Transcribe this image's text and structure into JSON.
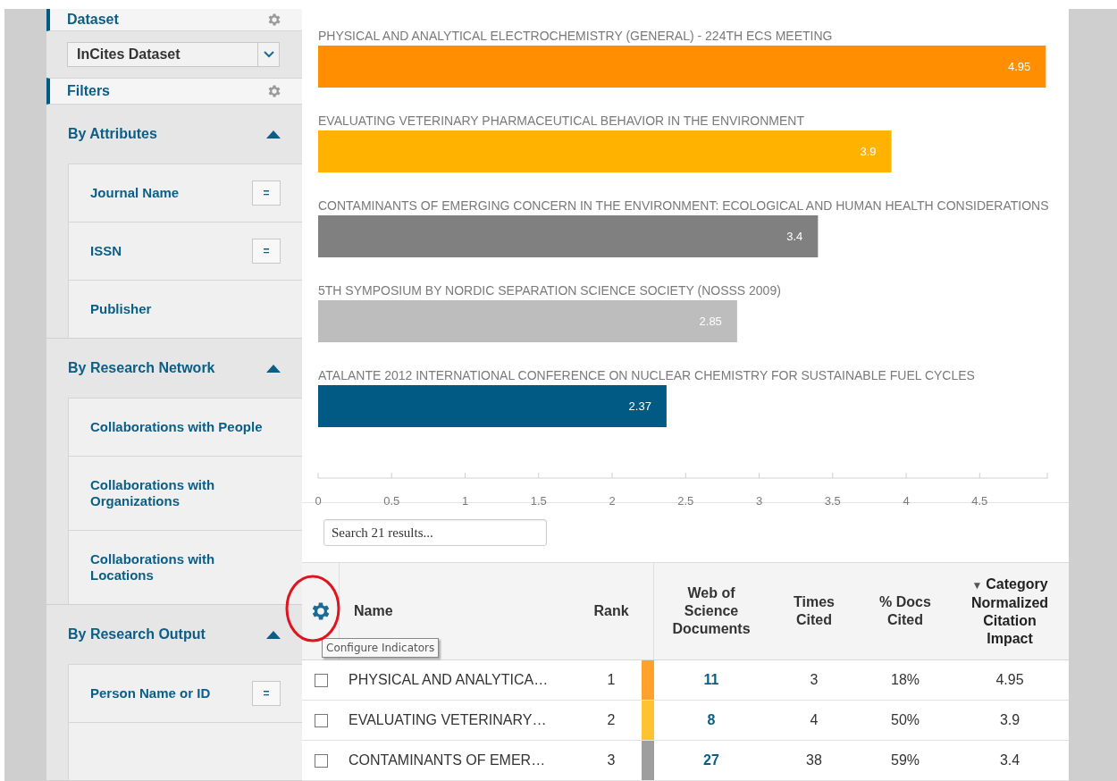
{
  "sidebar": {
    "dataset_header": "Dataset",
    "dataset_select": {
      "value": "InCites Dataset"
    },
    "filters_header": "Filters",
    "groups": [
      {
        "title": "By Attributes",
        "expanded": true,
        "items": [
          {
            "label": "Journal Name",
            "operator": "="
          },
          {
            "label": "ISSN",
            "operator": "="
          },
          {
            "label": "Publisher"
          }
        ]
      },
      {
        "title": "By Research Network",
        "expanded": true,
        "items": [
          {
            "label": "Collaborations with People"
          },
          {
            "label": "Collaborations with Organizations"
          },
          {
            "label": "Collaborations with Locations"
          }
        ]
      },
      {
        "title": "By Research Output",
        "expanded": true,
        "items": [
          {
            "label": "Person Name or ID",
            "operator": "="
          }
        ],
        "more_below": true
      }
    ]
  },
  "chart": {
    "chart_data": {
      "type": "bar",
      "orientation": "horizontal",
      "categories": [
        "PHYSICAL AND ANALYTICAL ELECTROCHEMISTRY (GENERAL) - 224TH ECS MEETING",
        "EVALUATING VETERINARY PHARMACEUTICAL BEHAVIOR IN THE ENVIRONMENT",
        "CONTAMINANTS OF EMERGING CONCERN IN THE ENVIRONMENT: ECOLOGICAL AND HUMAN HEALTH CONSIDERATIONS",
        "5TH SYMPOSIUM BY NORDIC SEPARATION SCIENCE SOCIETY (NOSSS 2009)",
        "ATALANTE 2012 INTERNATIONAL CONFERENCE ON NUCLEAR CHEMISTRY FOR SUSTAINABLE FUEL CYCLES"
      ],
      "series": [
        {
          "colors": [
            "#ff8f00",
            "#ffb300",
            "#808080",
            "#bdbdbd",
            "#005a84"
          ],
          "values": [
            4.95,
            3.9,
            3.4,
            2.85,
            2.37
          ]
        }
      ],
      "value_labels": [
        "4.95",
        "3.9",
        "3.4",
        "2.85",
        "2.37"
      ],
      "xlim": [
        0,
        4.96
      ],
      "xticks": [
        0,
        0.5,
        1,
        1.5,
        2,
        2.5,
        3,
        3.5,
        4,
        4.5
      ]
    }
  },
  "search": {
    "placeholder": "Search 21 results..."
  },
  "table": {
    "settings_tooltip": "Configure Indicators",
    "columns": [
      {
        "label": "Name",
        "sorted": false
      },
      {
        "label": "Rank",
        "sorted": false
      },
      {
        "label": "Web of Science Documents",
        "sorted": false
      },
      {
        "label": "Times Cited",
        "sorted": false
      },
      {
        "label": "% Docs Cited",
        "sorted": false
      },
      {
        "label": "Category Normalized Citation Impact",
        "sorted": true,
        "sort_marker": "▼"
      }
    ],
    "rows": [
      {
        "checked": false,
        "name": "PHYSICAL AND ANALYTICA…",
        "rank": "1",
        "color": "#ffa22b",
        "documents": "11",
        "times_cited": "3",
        "docs_cited": "18%",
        "impact": "4.95"
      },
      {
        "checked": false,
        "name": "EVALUATING VETERINARY…",
        "rank": "2",
        "color": "#ffc332",
        "documents": "8",
        "times_cited": "4",
        "docs_cited": "50%",
        "impact": "3.9"
      },
      {
        "checked": false,
        "name": "CONTAMINANTS OF EMER…",
        "rank": "3",
        "color": "#9e9e9e",
        "documents": "27",
        "times_cited": "38",
        "docs_cited": "59%",
        "impact": "3.4"
      }
    ]
  }
}
